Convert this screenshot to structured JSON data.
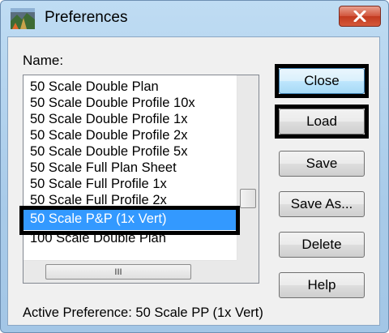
{
  "window": {
    "title": "Preferences",
    "title_icon": "landscape-icon",
    "close_icon": "close-x-icon"
  },
  "name_label": "Name:",
  "list": {
    "items": [
      "50 Scale Double Plan",
      "50 Scale Double Profile 10x",
      "50 Scale Double Profile 1x",
      "50 Scale Double Profile 2x",
      "50 Scale Double Profile 5x",
      "50 Scale Full Plan Sheet",
      "50 Scale Full Profile 1x",
      "50 Scale Full Profile 2x",
      "50 Scale P&P (1x Vert)",
      "100 Scale Double Plan"
    ],
    "selected_index": 8,
    "hscroll_grip": "III"
  },
  "buttons": {
    "close": "Close",
    "load": "Load",
    "save": "Save",
    "save_as": "Save As...",
    "delete": "Delete",
    "help": "Help"
  },
  "status": "Active Preference: 50 Scale PP (1x Vert)",
  "colors": {
    "selection": "#3399ff",
    "highlight_outline": "#000000",
    "title_close": "#c9452a"
  }
}
